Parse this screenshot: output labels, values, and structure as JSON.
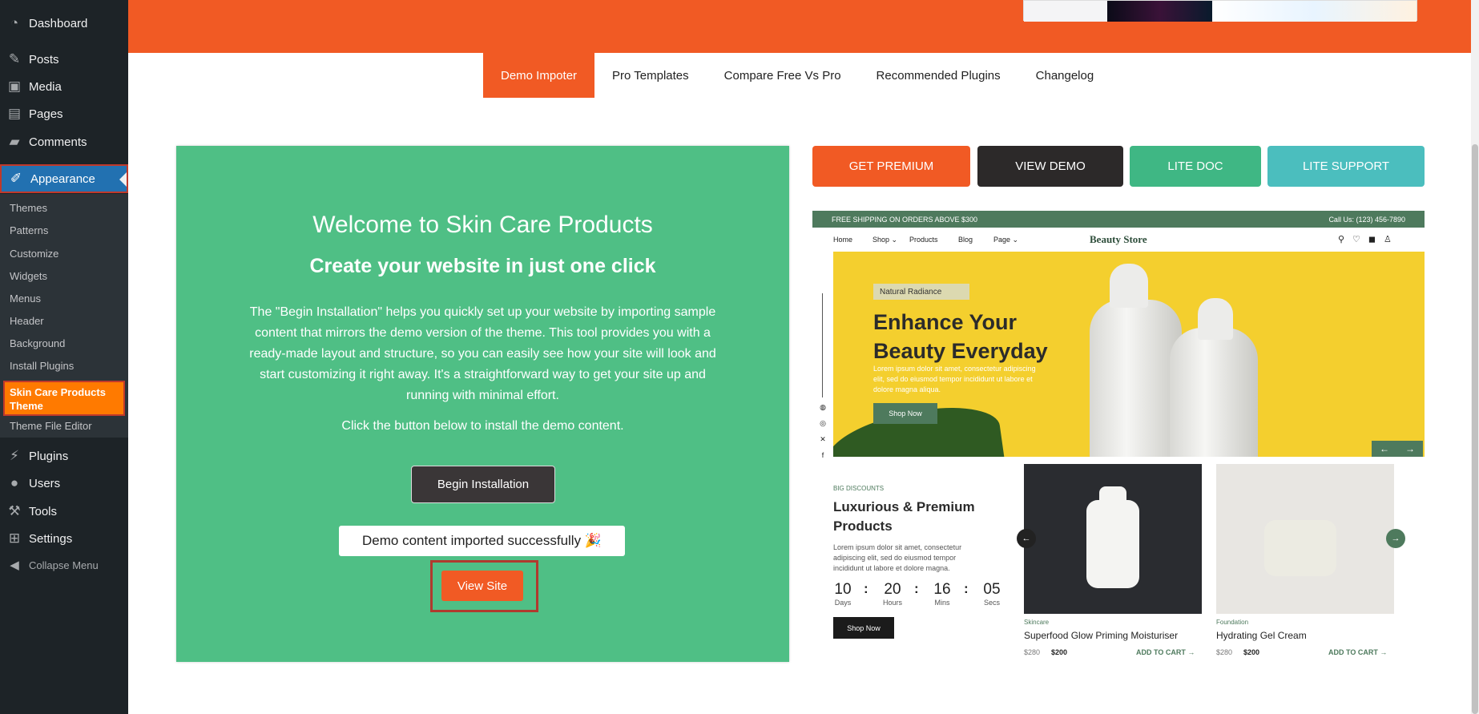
{
  "sidebar": {
    "dashboard": "Dashboard",
    "posts": "Posts",
    "media": "Media",
    "pages": "Pages",
    "comments": "Comments",
    "appearance": "Appearance",
    "submenu": [
      "Themes",
      "Patterns",
      "Customize",
      "Widgets",
      "Menus",
      "Header",
      "Background",
      "Install Plugins"
    ],
    "current_sub": "Skin Care Products Theme",
    "theme_file_editor": "Theme File Editor",
    "plugins": "Plugins",
    "users": "Users",
    "tools": "Tools",
    "settings": "Settings",
    "collapse": "Collapse Menu"
  },
  "tabs": [
    {
      "label": "Demo Impoter",
      "active": true
    },
    {
      "label": "Pro Templates",
      "active": false
    },
    {
      "label": "Compare Free Vs Pro",
      "active": false
    },
    {
      "label": "Recommended Plugins",
      "active": false
    },
    {
      "label": "Changelog",
      "active": false
    }
  ],
  "panel": {
    "title": "Welcome to Skin Care Products",
    "subtitle": "Create your website in just one click",
    "description": "The \"Begin Installation\" helps you quickly set up your website by importing sample content that mirrors the demo version of the theme. This tool provides you with a ready-made layout and structure, so you can easily see how your site will look and start customizing it right away. It's a straightforward way to get your site up and running with minimal effort.",
    "click_text": "Click the button below to install the demo content.",
    "begin_button": "Begin Installation",
    "success_message": "Demo content imported successfully 🎉",
    "view_site_button": "View Site"
  },
  "actions": {
    "get_premium": "GET PREMIUM",
    "view_demo": "VIEW DEMO",
    "lite_doc": "LITE DOC",
    "lite_support": "LITE SUPPORT"
  },
  "preview": {
    "topbar_left": "FREE SHIPPING ON ORDERS ABOVE $300",
    "topbar_right": "Call Us: (123) 456-7890",
    "nav": [
      "Home",
      "Shop ⌄",
      "Products",
      "Blog",
      "Page ⌄"
    ],
    "brand": "Beauty Store",
    "hero_tag": "Natural Radiance",
    "hero_title": "Enhance Your Beauty Everyday",
    "hero_text": "Lorem ipsum dolor sit amet, consectetur adipiscing elit, sed do eiusmod tempor incididunt ut labore et dolore magna aliqua.",
    "hero_button": "Shop Now",
    "deal_label": "BIG DISCOUNTS",
    "deal_title": "Luxurious & Premium Products",
    "deal_text": "Lorem ipsum dolor sit amet, consectetur adipiscing elit, sed do eiusmod tempor incididunt ut labore et dolore magna.",
    "countdown": [
      {
        "num": "10",
        "unit": "Days"
      },
      {
        "num": "20",
        "unit": "Hours"
      },
      {
        "num": "16",
        "unit": "Mins"
      },
      {
        "num": "05",
        "unit": "Secs"
      }
    ],
    "deal_button": "Shop Now",
    "products": [
      {
        "category": "Skincare",
        "name": "Superfood Glow Priming Moisturiser",
        "old_price": "$280",
        "price": "$200",
        "cart": "ADD TO CART →"
      },
      {
        "category": "Foundation",
        "name": "Hydrating Gel Cream",
        "old_price": "$280",
        "price": "$200",
        "cart": "ADD TO CART →"
      }
    ]
  },
  "colors": {
    "accent_orange": "#f15a24",
    "panel_green": "#4fbf85",
    "wp_sidebar": "#1d2327",
    "wp_blue": "#2271b1"
  }
}
